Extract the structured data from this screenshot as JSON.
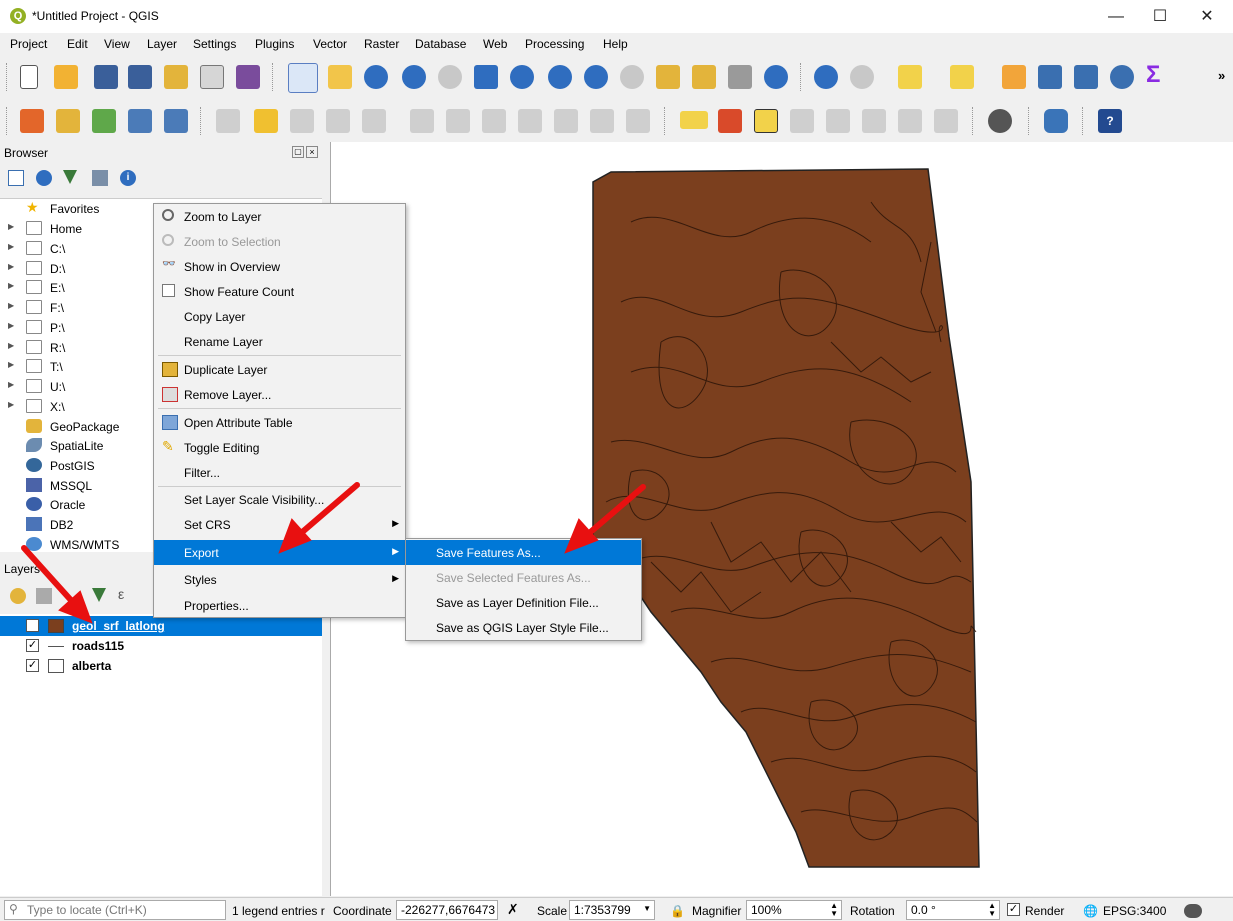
{
  "window": {
    "title": "*Untitled Project - QGIS",
    "app_icon": "qgis-logo-icon",
    "controls": [
      "minimize-icon",
      "maximize-icon",
      "close-icon"
    ]
  },
  "menubar": {
    "items": [
      "Project",
      "Edit",
      "View",
      "Layer",
      "Settings",
      "Plugins",
      "Vector",
      "Raster",
      "Database",
      "Web",
      "Processing",
      "Help"
    ]
  },
  "browser": {
    "title": "Browser",
    "items": [
      {
        "label": "Favorites",
        "icon": "star-icon"
      },
      {
        "label": "Home",
        "icon": "home-folder-icon"
      },
      {
        "label": "C:\\",
        "icon": "folder-icon"
      },
      {
        "label": "D:\\",
        "icon": "folder-icon"
      },
      {
        "label": "E:\\",
        "icon": "folder-icon"
      },
      {
        "label": "F:\\",
        "icon": "folder-icon"
      },
      {
        "label": "P:\\",
        "icon": "folder-icon"
      },
      {
        "label": "R:\\",
        "icon": "folder-icon"
      },
      {
        "label": "T:\\",
        "icon": "folder-icon"
      },
      {
        "label": "U:\\",
        "icon": "folder-icon"
      },
      {
        "label": "X:\\",
        "icon": "folder-icon"
      },
      {
        "label": "GeoPackage",
        "icon": "geopackage-icon"
      },
      {
        "label": "SpatiaLite",
        "icon": "spatialite-icon"
      },
      {
        "label": "PostGIS",
        "icon": "postgis-icon"
      },
      {
        "label": "MSSQL",
        "icon": "mssql-icon"
      },
      {
        "label": "Oracle",
        "icon": "oracle-icon"
      },
      {
        "label": "DB2",
        "icon": "db2-icon"
      },
      {
        "label": "WMS/WMTS",
        "icon": "wms-icon"
      }
    ]
  },
  "layers": {
    "title": "Layers",
    "items": [
      {
        "label": "geol_srf_latlong",
        "checked": "✓",
        "symbol": "polygon-fill",
        "color": "#7b3f1e"
      },
      {
        "label": "roads115",
        "checked": "✓",
        "symbol": "line"
      },
      {
        "label": "alberta",
        "checked": "✓",
        "symbol": "polygon-empty"
      }
    ]
  },
  "context_menu": {
    "items": [
      {
        "label": "Zoom to Layer",
        "icon": "zoom-layer-icon"
      },
      {
        "label": "Zoom to Selection",
        "icon": "zoom-selection-icon",
        "disabled": true
      },
      {
        "label": "Show in Overview",
        "icon": "overview-icon"
      },
      {
        "label": "Show Feature Count",
        "icon": "checkbox-icon"
      },
      {
        "label": "Copy Layer"
      },
      {
        "label": "Rename Layer"
      },
      {
        "label": "Duplicate Layer",
        "icon": "duplicate-icon"
      },
      {
        "label": "Remove Layer...",
        "icon": "remove-layer-icon"
      },
      {
        "label": "Open Attribute Table",
        "icon": "table-icon"
      },
      {
        "label": "Toggle Editing",
        "icon": "pencil-icon"
      },
      {
        "label": "Filter..."
      },
      {
        "label": "Set Layer Scale Visibility..."
      },
      {
        "label": "Set CRS",
        "submenu": true
      },
      {
        "label": "Export",
        "submenu": true,
        "highlighted": true
      },
      {
        "label": "Styles",
        "submenu": true
      },
      {
        "label": "Properties..."
      }
    ]
  },
  "export_submenu": {
    "items": [
      {
        "label": "Save Features As...",
        "highlighted": true
      },
      {
        "label": "Save Selected Features As...",
        "disabled": true
      },
      {
        "label": "Save as Layer Definition File..."
      },
      {
        "label": "Save as QGIS Layer Style File..."
      }
    ]
  },
  "statusbar": {
    "locate_placeholder": "Type to locate (Ctrl+K)",
    "legend_msg": "1 legend entries r",
    "coordinate_label": "Coordinate",
    "coordinate_value": "-226277,6676473",
    "scale_label": "Scale",
    "scale_value": "1:7353799",
    "magnifier_label": "Magnifier",
    "magnifier_value": "100%",
    "rotation_label": "Rotation",
    "rotation_value": "0.0 °",
    "render_label": "Render",
    "render_checked": "✓",
    "crs": "EPSG:3400"
  },
  "colors": {
    "map_fill": "#7b3f1e",
    "highlight": "#0078d7",
    "annotation_arrow": "#e81010"
  }
}
